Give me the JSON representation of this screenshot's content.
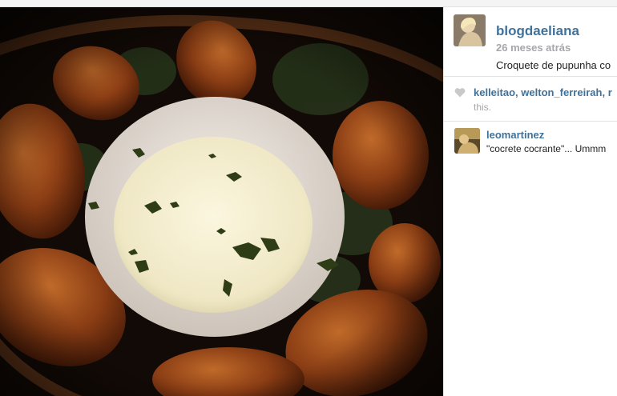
{
  "post": {
    "owner": "blogdaeliana",
    "timestamp": "26 meses atrás",
    "caption": "Croquete de pupunha co",
    "likes": {
      "users": [
        "kelleitao",
        "welton_ferreirah"
      ],
      "separator": ",",
      "trailing": "r",
      "suffix": "this."
    },
    "comments": [
      {
        "user": "leomartinez",
        "text": "\"cocrete cocrante\"... Ummm"
      }
    ]
  },
  "icons": {
    "heart": "heart-icon"
  },
  "colors": {
    "username": "#3f729b",
    "muted": "#a5a7aa",
    "text": "#222222"
  }
}
